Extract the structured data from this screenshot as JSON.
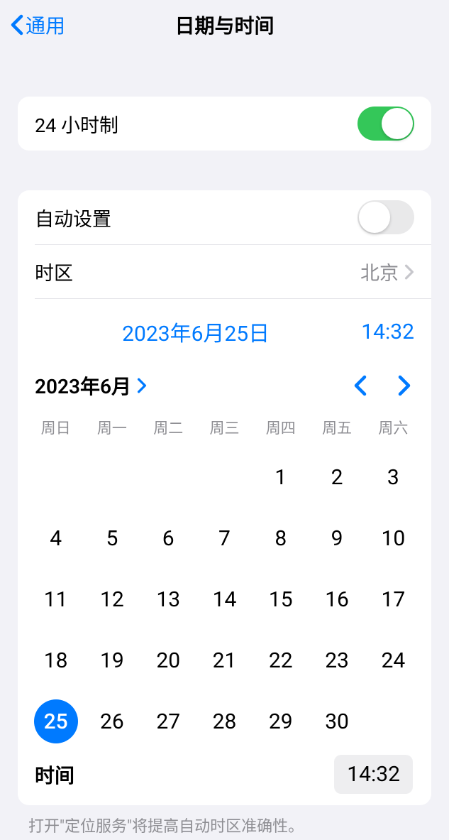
{
  "header": {
    "back_label": "通用",
    "title": "日期与时间"
  },
  "settings": {
    "use_24h_label": "24 小时制",
    "use_24h_on": true,
    "auto_set_label": "自动设置",
    "auto_set_on": false,
    "timezone_label": "时区",
    "timezone_value": "北京",
    "selected_date_text": "2023年6月25日",
    "selected_time_text": "14:32"
  },
  "calendar": {
    "month_label": "2023年6月",
    "weekdays": [
      "周日",
      "周一",
      "周二",
      "周三",
      "周四",
      "周五",
      "周六"
    ],
    "leading_blanks": 4,
    "days": [
      1,
      2,
      3,
      4,
      5,
      6,
      7,
      8,
      9,
      10,
      11,
      12,
      13,
      14,
      15,
      16,
      17,
      18,
      19,
      20,
      21,
      22,
      23,
      24,
      25,
      26,
      27,
      28,
      29,
      30
    ],
    "selected_day": 25,
    "time_label": "时间",
    "time_value": "14:32"
  },
  "footer": {
    "note": "打开\"定位服务\"将提高自动时区准确性。"
  }
}
